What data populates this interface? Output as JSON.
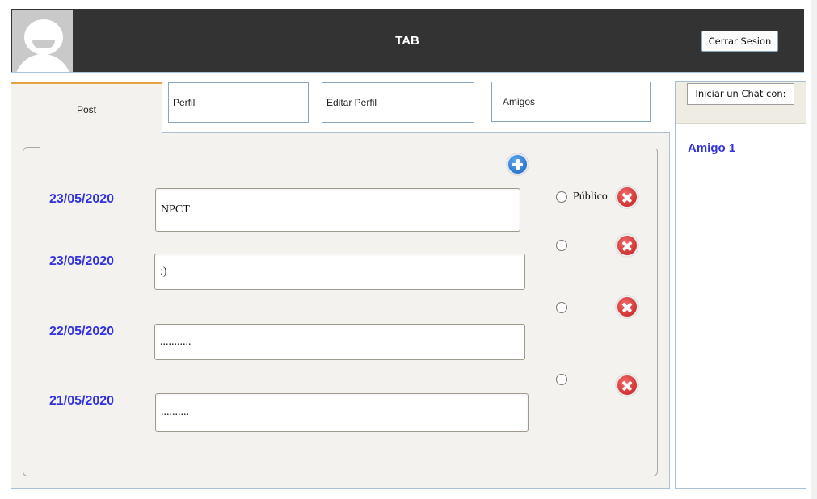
{
  "header": {
    "title": "TAB",
    "logout_label": "Cerrar Sesion"
  },
  "tabs": [
    {
      "label": "Post",
      "active": true
    },
    {
      "label": "Perfil",
      "active": false
    },
    {
      "label": "Editar Perfil",
      "active": false
    },
    {
      "label": "Amigos",
      "active": false
    }
  ],
  "posts": [
    {
      "date": "23/05/2020",
      "text": "NPCT",
      "visibility_label": "Público"
    },
    {
      "date": "23/05/2020",
      "text": ":)",
      "visibility_label": ""
    },
    {
      "date": "22/05/2020",
      "text": "...........",
      "visibility_label": ""
    },
    {
      "date": "21/05/2020",
      "text": "..........",
      "visibility_label": ""
    }
  ],
  "chat": {
    "start_label": "Iniciar un Chat con:",
    "friends": [
      "Amigo 1"
    ]
  },
  "colors": {
    "header_bg": "#333333",
    "active_tab_accent": "#e4a243",
    "date_color": "#3333dd",
    "panel_bg": "#f3f2ee"
  },
  "icons": {
    "add": "plus-circle-icon",
    "delete": "close-circle-icon",
    "avatar": "user-avatar-icon"
  }
}
